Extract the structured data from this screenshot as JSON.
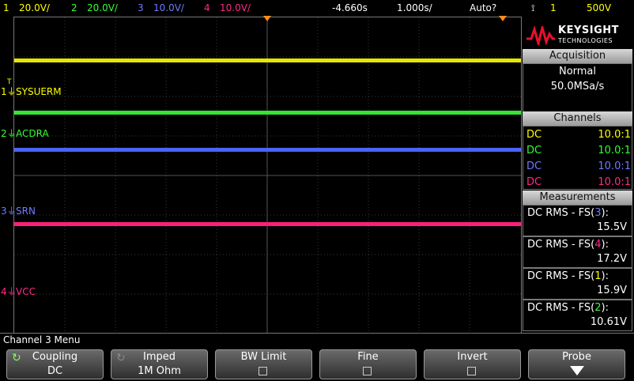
{
  "top_bar": {
    "ch1_num": "1",
    "ch1_scale": "20.0V/",
    "ch2_num": "2",
    "ch2_scale": "20.0V/",
    "ch3_num": "3",
    "ch3_scale": "10.0V/",
    "ch4_num": "4",
    "ch4_scale": "10.0V/",
    "time_offset": "-4.660s",
    "time_scale": "1.000s/",
    "trigger_mode": "Auto?",
    "trigger_symbol": "⟟",
    "trigger_source": "1",
    "trigger_level": "500V"
  },
  "traces": [
    {
      "label": "SYSUERM",
      "num": "1",
      "color": "#ffff00"
    },
    {
      "label": "ACDRA",
      "num": "2",
      "color": "#33ff33"
    },
    {
      "label": "SRN",
      "num": "3",
      "color": "#4a63ff"
    },
    {
      "label": "VCC",
      "num": "4",
      "color": "#ff1f7a"
    }
  ],
  "logo": {
    "brand": "KEYSIGHT",
    "sub": "TECHNOLOGIES"
  },
  "acquisition": {
    "title": "Acquisition",
    "mode": "Normal",
    "rate": "50.0MSa/s"
  },
  "channels": {
    "title": "Channels",
    "rows": [
      {
        "coupling": "DC",
        "probe": "10.0:1",
        "color": "#ffff00"
      },
      {
        "coupling": "DC",
        "probe": "10.0:1",
        "color": "#33ff33"
      },
      {
        "coupling": "DC",
        "probe": "10.0:1",
        "color": "#6e7bff"
      },
      {
        "coupling": "DC",
        "probe": "10.0:1",
        "color": "#ff2a8a"
      }
    ]
  },
  "measurements": {
    "title": "Measurements",
    "items": [
      {
        "prefix": "DC RMS - FS(",
        "ch": "3",
        "suffix": "):",
        "value": "15.5V",
        "color": "#6e7bff"
      },
      {
        "prefix": "DC RMS - FS(",
        "ch": "4",
        "suffix": "):",
        "value": "17.2V",
        "color": "#ff2a8a"
      },
      {
        "prefix": "DC RMS - FS(",
        "ch": "1",
        "suffix": "):",
        "value": "15.9V",
        "color": "#ffff00"
      },
      {
        "prefix": "DC RMS - FS(",
        "ch": "2",
        "suffix": "):",
        "value": "10.61V",
        "color": "#33ff33"
      }
    ]
  },
  "menu": {
    "title": "Channel 3 Menu",
    "softkeys": [
      {
        "label": "Coupling",
        "value": "DC"
      },
      {
        "label": "Imped",
        "value": "1M Ohm"
      },
      {
        "label": "BW Limit",
        "value": ""
      },
      {
        "label": "Fine",
        "value": ""
      },
      {
        "label": "Invert",
        "value": ""
      },
      {
        "label": "Probe",
        "value": ""
      }
    ]
  }
}
